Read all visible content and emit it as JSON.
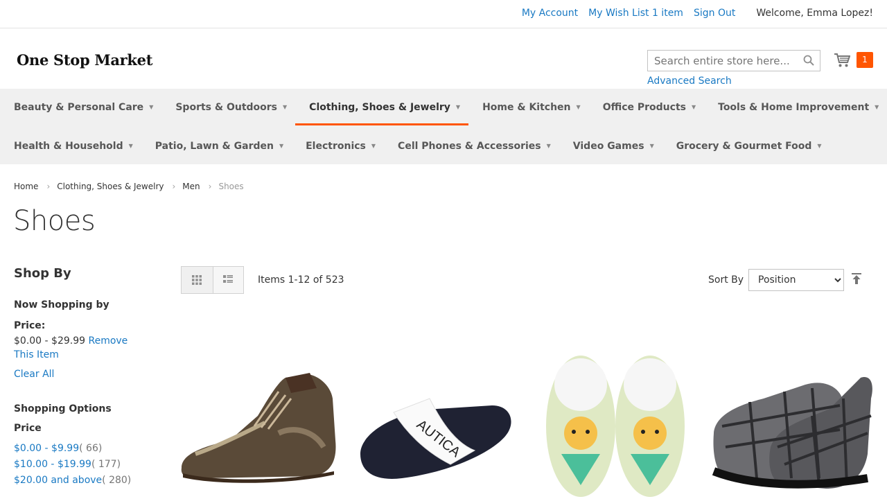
{
  "header": {
    "links": [
      "My Account",
      "My Wish List 1 item",
      "Sign Out"
    ],
    "welcome": "Welcome, Emma Lopez!",
    "logo_text": "One Stop Market",
    "search_placeholder": "Search entire store here...",
    "advanced_search": "Advanced Search",
    "cart_count": "1",
    "accent_color": "#ff5501",
    "link_color": "#1979c3"
  },
  "nav": {
    "row1": [
      "Beauty & Personal Care",
      "Sports & Outdoors",
      "Clothing, Shoes & Jewelry",
      "Home & Kitchen",
      "Office Products",
      "Tools & Home Improvement"
    ],
    "row2": [
      "Health & Household",
      "Patio, Lawn & Garden",
      "Electronics",
      "Cell Phones & Accessories",
      "Video Games",
      "Grocery & Gourmet Food"
    ],
    "active": "Clothing, Shoes & Jewelry"
  },
  "breadcrumb": [
    "Home",
    "Clothing, Shoes & Jewelry",
    "Men",
    "Shoes"
  ],
  "page_title": "Shoes",
  "sidebar": {
    "shop_by": "Shop By",
    "now_shopping": "Now Shopping by",
    "filter_label": "Price:",
    "filter_value": "$0.00 - $29.99",
    "remove": "Remove This Item",
    "clear_all": "Clear All",
    "shopping_options": "Shopping Options",
    "price_header": "Price",
    "price_options": [
      {
        "range": "$0.00 - $9.99",
        "count": "( 66)"
      },
      {
        "range": "$10.00 - $19.99",
        "count": "( 177)"
      },
      {
        "range": "$20.00 and above",
        "count": "( 280)"
      }
    ]
  },
  "toolbar": {
    "items": "Items 1-12 of 523",
    "sort_by": "Sort By",
    "sort_options": [
      "Position"
    ]
  },
  "products": [
    {
      "icon": "leather-boot"
    },
    {
      "icon": "slide-sandal"
    },
    {
      "icon": "pineapple-slippers"
    },
    {
      "icon": "plaid-slippers"
    }
  ]
}
